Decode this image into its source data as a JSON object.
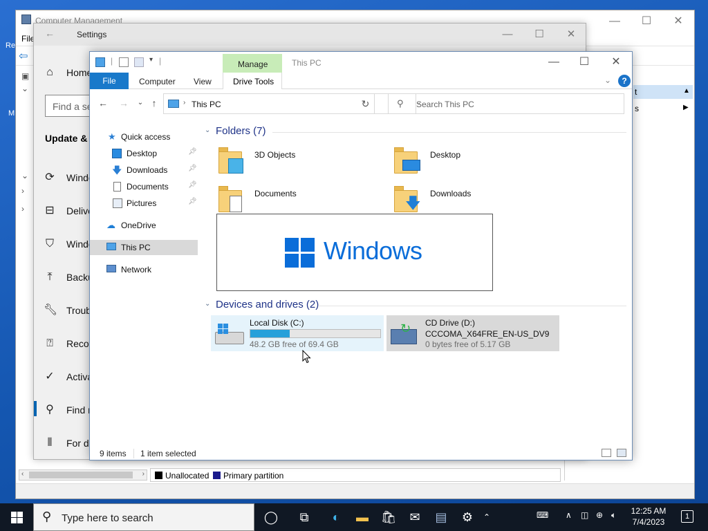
{
  "computer_management": {
    "title": "Computer Management",
    "menu_file": "File",
    "left_labels": [
      "Re",
      "M"
    ],
    "actions_item1": "t",
    "actions_item2": "s",
    "legend_unallocated": "Unallocated",
    "legend_primary": "Primary partition",
    "colors": {
      "unallocated": "#000000",
      "primary": "#1a1a8c"
    }
  },
  "settings": {
    "title": "Settings",
    "home": "Home",
    "search_placeholder": "Find a se",
    "section": "Update & S",
    "nav": [
      {
        "label": "Windo",
        "icon": "sync-icon"
      },
      {
        "label": "Delive",
        "icon": "delivery-icon"
      },
      {
        "label": "Windo",
        "icon": "shield-icon"
      },
      {
        "label": "Backu",
        "icon": "backup-icon"
      },
      {
        "label": "Troub",
        "icon": "wrench-icon"
      },
      {
        "label": "Recov",
        "icon": "recovery-icon"
      },
      {
        "label": "Activa",
        "icon": "check-circle-icon"
      },
      {
        "label": "Find n",
        "icon": "find-device-icon"
      },
      {
        "label": "For de",
        "icon": "developer-icon"
      }
    ]
  },
  "explorer": {
    "title": "This PC",
    "manage_tab": "Manage",
    "tabs": {
      "file": "File",
      "computer": "Computer",
      "view": "View",
      "drive_tools": "Drive Tools"
    },
    "address": "This PC",
    "search_placeholder": "Search This PC",
    "tree": {
      "quick_access": "Quick access",
      "desktop": "Desktop",
      "downloads": "Downloads",
      "documents": "Documents",
      "pictures": "Pictures",
      "onedrive": "OneDrive",
      "this_pc": "This PC",
      "network": "Network"
    },
    "folders_header": "Folders (7)",
    "folders": [
      {
        "name": "3D Objects"
      },
      {
        "name": "Desktop"
      },
      {
        "name": "Documents"
      },
      {
        "name": "Downloads"
      }
    ],
    "windows_overlay": "Windows",
    "devices_header": "Devices and drives (2)",
    "drives": [
      {
        "name": "Local Disk (C:)",
        "free": "48.2 GB free of 69.4 GB",
        "used_fraction": 0.305
      },
      {
        "name": "CD Drive (D:)",
        "label": "CCCOMA_X64FRE_EN-US_DV9",
        "free": "0 bytes free of 5.17 GB"
      }
    ],
    "status_items": "9 items",
    "status_selected": "1 item selected",
    "colors": {
      "file_tab": "#1979ca",
      "manage_tab": "#c8ecb8",
      "accent": "#26a0da"
    }
  },
  "taskbar": {
    "search_placeholder": "Type here to search",
    "time": "12:25 AM",
    "date": "7/4/2023",
    "notification_count": "1"
  }
}
